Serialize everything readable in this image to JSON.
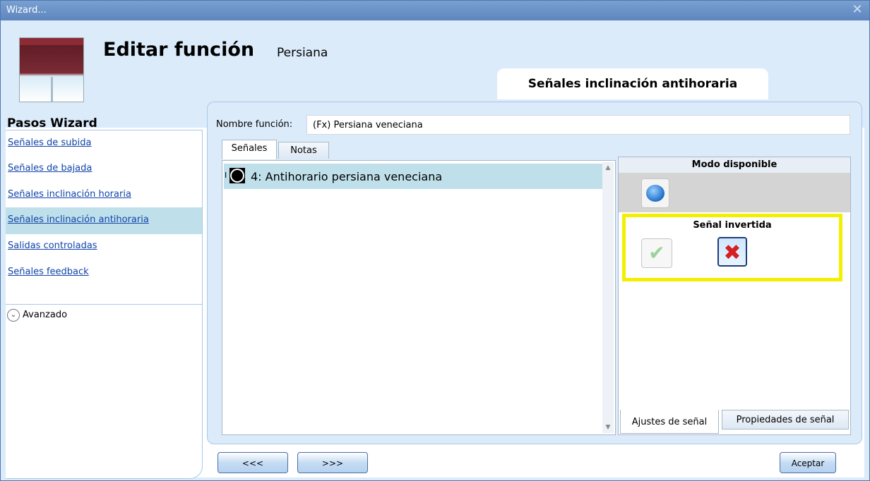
{
  "window": {
    "title": "Wizard...",
    "close_glyph": "✕"
  },
  "header": {
    "heading": "Editar función",
    "subheading": "Persiana",
    "icon": "venetian-blind-icon"
  },
  "step_tab": {
    "label": "Señales inclinación antihoraria"
  },
  "sidebar": {
    "title": "Pasos Wizard",
    "items": [
      {
        "label": "Señales de subida"
      },
      {
        "label": "Señales de bajada"
      },
      {
        "label": "Señales inclinación horaria"
      },
      {
        "label": "Señales inclinación antihoraria",
        "active": true
      },
      {
        "label": "Salidas controladas"
      },
      {
        "label": "Señales feedback"
      }
    ],
    "advanced": {
      "label": "Avanzado",
      "glyph": "⌄"
    }
  },
  "function": {
    "name_label": "Nombre función:",
    "name_value": "(Fx) Persiana veneciana"
  },
  "tabs": [
    {
      "label": "Señales",
      "selected": true
    },
    {
      "label": "Notas",
      "selected": false
    }
  ],
  "signal_list": {
    "cursor_glyph": "I",
    "items": [
      {
        "label": "4: Antihorario persiana veneciana",
        "icon": "signal-node-icon"
      }
    ],
    "scroll_up": "▲",
    "scroll_down": "▼"
  },
  "signal_panel": {
    "mode_header": "Modo disponible",
    "mode_icon": "pushbutton-icon",
    "inverted_header": "Señal invertida",
    "check_glyph": "✔",
    "x_glyph": "✖",
    "highlight_color": "#f4ef00",
    "bottom_tabs": [
      {
        "label": "Ajustes de señal",
        "selected": true
      },
      {
        "label": "Propiedades de señal",
        "selected": false
      }
    ]
  },
  "footer": {
    "prev_label": "<<<",
    "next_label": ">>>",
    "accept_label": "Aceptar"
  }
}
